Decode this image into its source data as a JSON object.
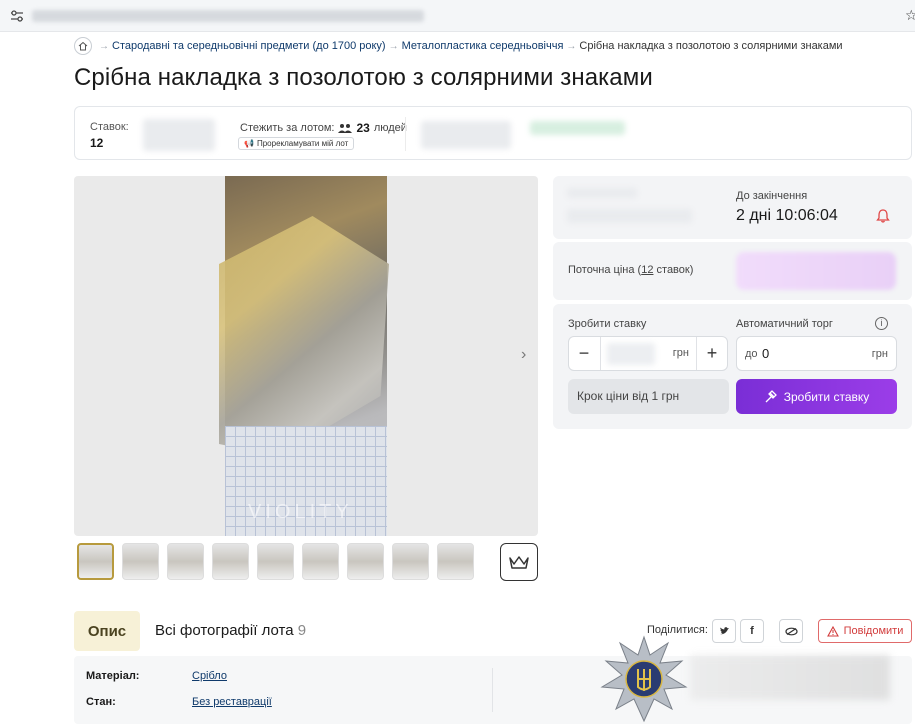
{
  "breadcrumb": {
    "items": [
      "Стародавні та середньовічні предмети (до 1700 року)",
      "Металопластика середньовіччя",
      "Срібна накладка з позолотою з солярними знаками"
    ]
  },
  "title": "Срібна накладка з позолотою з солярними знаками",
  "strip": {
    "bids_label": "Ставок:",
    "bids_value": "12",
    "watch_label": "Стежить за лотом:",
    "watch_count": "23",
    "watch_unit": "людей",
    "promo_label": "Прорекламувати мій лот"
  },
  "gallery": {
    "watermark": "VIOLITY",
    "thumb_count": 9
  },
  "timer": {
    "label": "До закінчення",
    "value": "2 дні 10:06:04"
  },
  "price": {
    "label_pre": "Поточна ціна (",
    "bids_link": "12",
    "label_post": " ставок)"
  },
  "bid": {
    "make_bid_label": "Зробити ставку",
    "auto_label": "Автоматичний торг",
    "currency": "грн",
    "auto_prefix": "до",
    "auto_value": "0",
    "step_note": "Крок ціни від 1 грн",
    "button_label": "Зробити ставку"
  },
  "tabs": {
    "description": "Опис",
    "all_photos": "Всі фотографії лота",
    "all_photos_count": "9"
  },
  "share": {
    "label": "Поділитися:",
    "report": "Повідомити"
  },
  "specs": [
    {
      "key": "Матеріал:",
      "value": "Срібло"
    },
    {
      "key": "Стан:",
      "value": "Без реставрації"
    }
  ],
  "colors": {
    "accent": "#8a2be2",
    "link": "#0f3a6b",
    "report": "#d23c3c"
  }
}
